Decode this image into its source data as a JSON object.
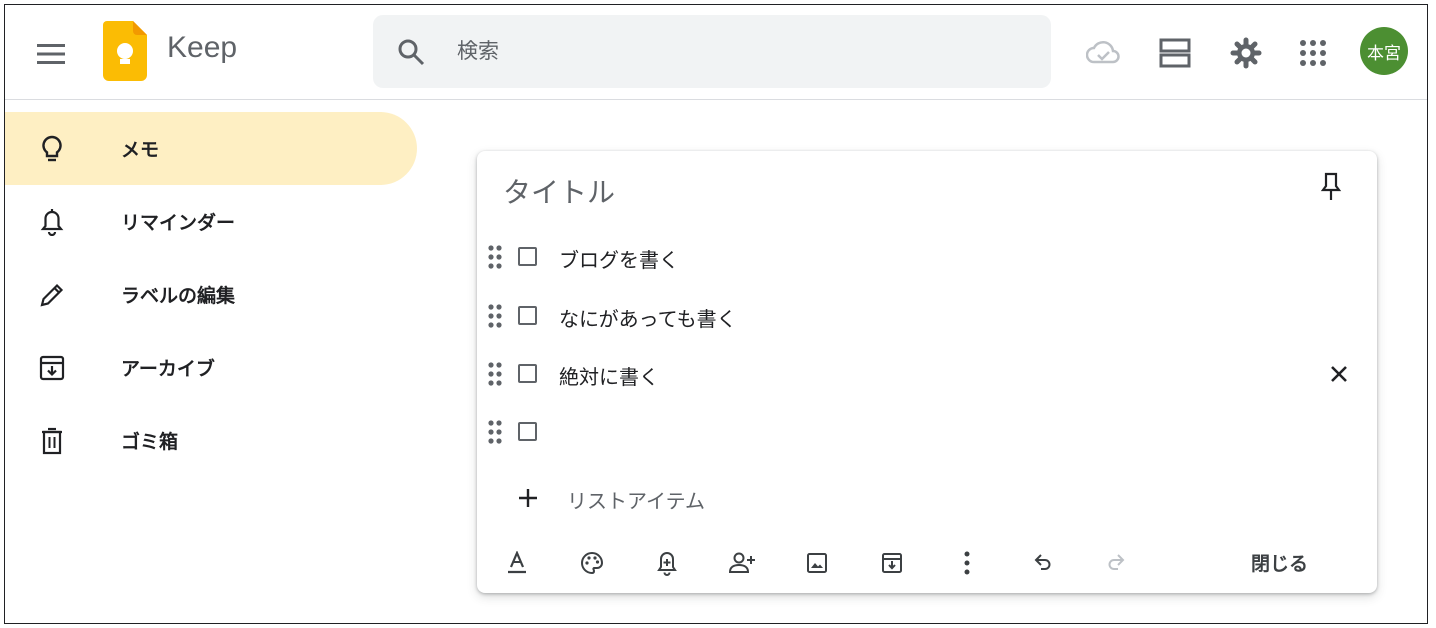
{
  "app": {
    "name": "Keep"
  },
  "search": {
    "placeholder": "検索"
  },
  "account": {
    "avatar_text": "本宮",
    "avatar_color": "#4c8f32"
  },
  "sidebar": {
    "items": [
      {
        "label": "メモ",
        "icon": "lightbulb-icon",
        "active": true
      },
      {
        "label": "リマインダー",
        "icon": "bell-icon",
        "active": false
      },
      {
        "label": "ラベルの編集",
        "icon": "pencil-icon",
        "active": false
      },
      {
        "label": "アーカイブ",
        "icon": "archive-icon",
        "active": false
      },
      {
        "label": "ゴミ箱",
        "icon": "trash-icon",
        "active": false
      }
    ]
  },
  "note": {
    "title_placeholder": "タイトル",
    "items": [
      {
        "text": "ブログを書く",
        "checked": false
      },
      {
        "text": "なにがあっても書く",
        "checked": false
      },
      {
        "text": "絶対に書く",
        "checked": false
      },
      {
        "text": "",
        "checked": false
      }
    ],
    "add_item_label": "リストアイテム",
    "close_label": "閉じる"
  },
  "colors": {
    "accent": "#feefc3",
    "logo": "#fbbc04"
  }
}
